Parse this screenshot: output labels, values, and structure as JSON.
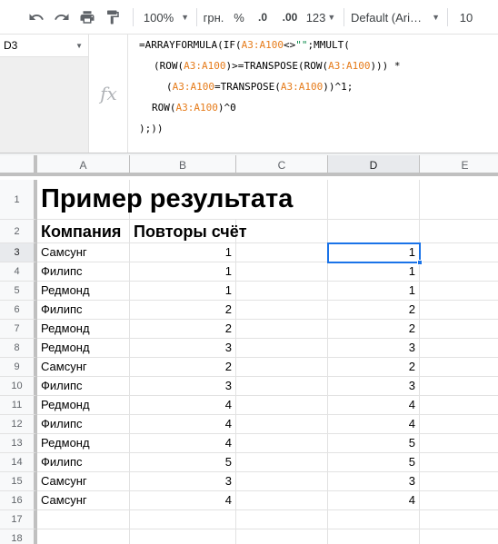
{
  "toolbar": {
    "zoom": "100%",
    "currency": "грн.",
    "percent": "%",
    "decrease_decimals": ".0",
    "increase_decimals": ".00",
    "more_formats": "123",
    "font": "Default (Ari…",
    "font_size": "10"
  },
  "name_box": "D3",
  "formula_bar": {
    "lines": [
      [
        {
          "t": "=ARRAYFORMULA(IF(",
          "c": "txt"
        },
        {
          "t": "A3:A100",
          "c": "ref"
        },
        {
          "t": "<>",
          "c": "txt"
        },
        {
          "t": "\"\"",
          "c": "str"
        },
        {
          "t": ";MMULT(",
          "c": "txt"
        }
      ],
      [
        {
          "t": "(ROW(",
          "c": "txt"
        },
        {
          "t": "A3:A100",
          "c": "ref"
        },
        {
          "t": ")>=TRANSPOSE(ROW(",
          "c": "txt"
        },
        {
          "t": "A3:A100",
          "c": "ref"
        },
        {
          "t": "))) *",
          "c": "txt"
        }
      ],
      [
        {
          "t": "(",
          "c": "txt"
        },
        {
          "t": "A3:A100",
          "c": "ref"
        },
        {
          "t": "=TRANSPOSE(",
          "c": "txt"
        },
        {
          "t": "A3:A100",
          "c": "ref"
        },
        {
          "t": "))^1;",
          "c": "txt"
        }
      ],
      [
        {
          "t": "ROW(",
          "c": "txt"
        },
        {
          "t": "A3:A100",
          "c": "ref"
        },
        {
          "t": ")^0",
          "c": "txt"
        }
      ],
      [
        {
          "t": ");))",
          "c": "txt"
        }
      ]
    ]
  },
  "columns": [
    "A",
    "B",
    "C",
    "D",
    "E"
  ],
  "selected_column": "D",
  "selected_row": 3,
  "row_numbers": [
    "1",
    "2",
    "3",
    "4",
    "5",
    "6",
    "7",
    "8",
    "9",
    "10",
    "11",
    "12",
    "13",
    "14",
    "15",
    "16",
    "17",
    "18"
  ],
  "sheet": {
    "title": "Пример результата",
    "header_a": "Компания",
    "header_b": "Повторы счёт",
    "rows": [
      {
        "a": "Самсунг",
        "b": "1",
        "d": "1"
      },
      {
        "a": "Филипс",
        "b": "1",
        "d": "1"
      },
      {
        "a": "Редмонд",
        "b": "1",
        "d": "1"
      },
      {
        "a": "Филипс",
        "b": "2",
        "d": "2"
      },
      {
        "a": "Редмонд",
        "b": "2",
        "d": "2"
      },
      {
        "a": "Редмонд",
        "b": "3",
        "d": "3"
      },
      {
        "a": "Самсунг",
        "b": "2",
        "d": "2"
      },
      {
        "a": "Филипс",
        "b": "3",
        "d": "3"
      },
      {
        "a": "Редмонд",
        "b": "4",
        "d": "4"
      },
      {
        "a": "Филипс",
        "b": "4",
        "d": "4"
      },
      {
        "a": "Редмонд",
        "b": "4",
        "d": "5"
      },
      {
        "a": "Филипс",
        "b": "5",
        "d": "5"
      },
      {
        "a": "Самсунг",
        "b": "3",
        "d": "3"
      },
      {
        "a": "Самсунг",
        "b": "4",
        "d": "4"
      }
    ]
  },
  "colors": {
    "selection": "#1a73e8",
    "range_ref": "#e67c1b",
    "string_literal": "#0a8a4a"
  }
}
